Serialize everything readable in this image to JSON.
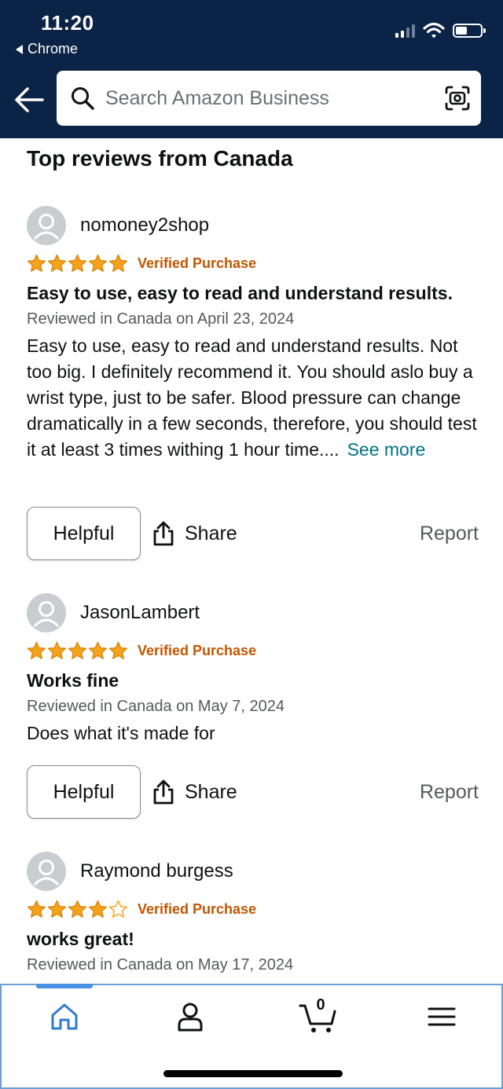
{
  "status_bar": {
    "time": "11:20",
    "back_app": "Chrome"
  },
  "header": {
    "search_placeholder": "Search Amazon Business"
  },
  "section_title": "Top reviews from Canada",
  "reviews": [
    {
      "name": "nomoney2shop",
      "stars": 5,
      "verified": "Verified Purchase",
      "title": "Easy to use, easy to read and understand results.",
      "date": "Reviewed in Canada on April 23, 2024",
      "body": "Easy to use, easy to read and understand results. Not too big. I definitely recommend it. You should aslo buy a wrist type, just to be safer. Blood pressure can change dramatically in a few seconds, therefore, you should test it at least 3 times withing 1 hour time....",
      "see_more": "See more",
      "helpful": "Helpful",
      "share": "Share",
      "report": "Report"
    },
    {
      "name": "JasonLambert",
      "stars": 5,
      "verified": "Verified Purchase",
      "title": "Works fine",
      "date": "Reviewed in Canada on May 7, 2024",
      "body": "Does what it's made for",
      "helpful": "Helpful",
      "share": "Share",
      "report": "Report"
    },
    {
      "name": "Raymond burgess",
      "stars": 4,
      "verified": "Verified Purchase",
      "title": "works great!",
      "date": "Reviewed in Canada on May 17, 2024"
    }
  ],
  "bottom_nav": {
    "items": [
      "home-icon",
      "account-icon",
      "cart-icon",
      "menu-icon"
    ],
    "cart_count": "0"
  },
  "colors": {
    "header_bg": "#0b2346",
    "star": "#f7a21b",
    "verified": "#c45500",
    "link": "#007185",
    "nav_accent": "#4a90e2"
  }
}
